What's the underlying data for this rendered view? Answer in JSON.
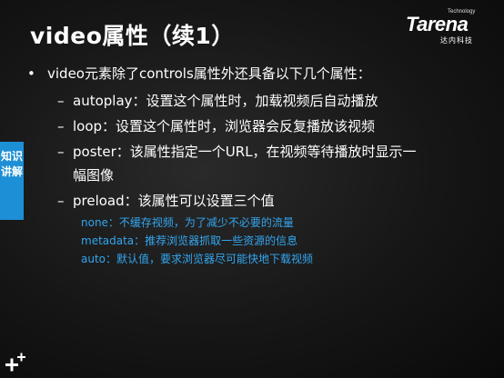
{
  "slide": {
    "title": "video属性（续1）",
    "logo": {
      "small": "Technology",
      "main": "Tarena",
      "sub": "达内科技"
    },
    "side_tab": "知识讲解",
    "bullet": "video元素除了controls属性外还具备以下几个属性：",
    "subitems": [
      {
        "text": "autoplay：设置这个属性时，加载视频后自动播放"
      },
      {
        "text": "loop：设置这个属性时，浏览器会反复播放该视频"
      },
      {
        "text": "poster：该属性指定一个URL，在视频等待播放时显示一"
      },
      {
        "text": "preload：该属性可以设置三个值"
      }
    ],
    "poster_continuation": "幅图像",
    "notes": [
      "none：不缓存视频，为了减少不必要的流量",
      "metadata：推荐浏览器抓取一些资源的信息",
      "auto：默认值，要求浏览器尽可能快地下载视频"
    ]
  }
}
